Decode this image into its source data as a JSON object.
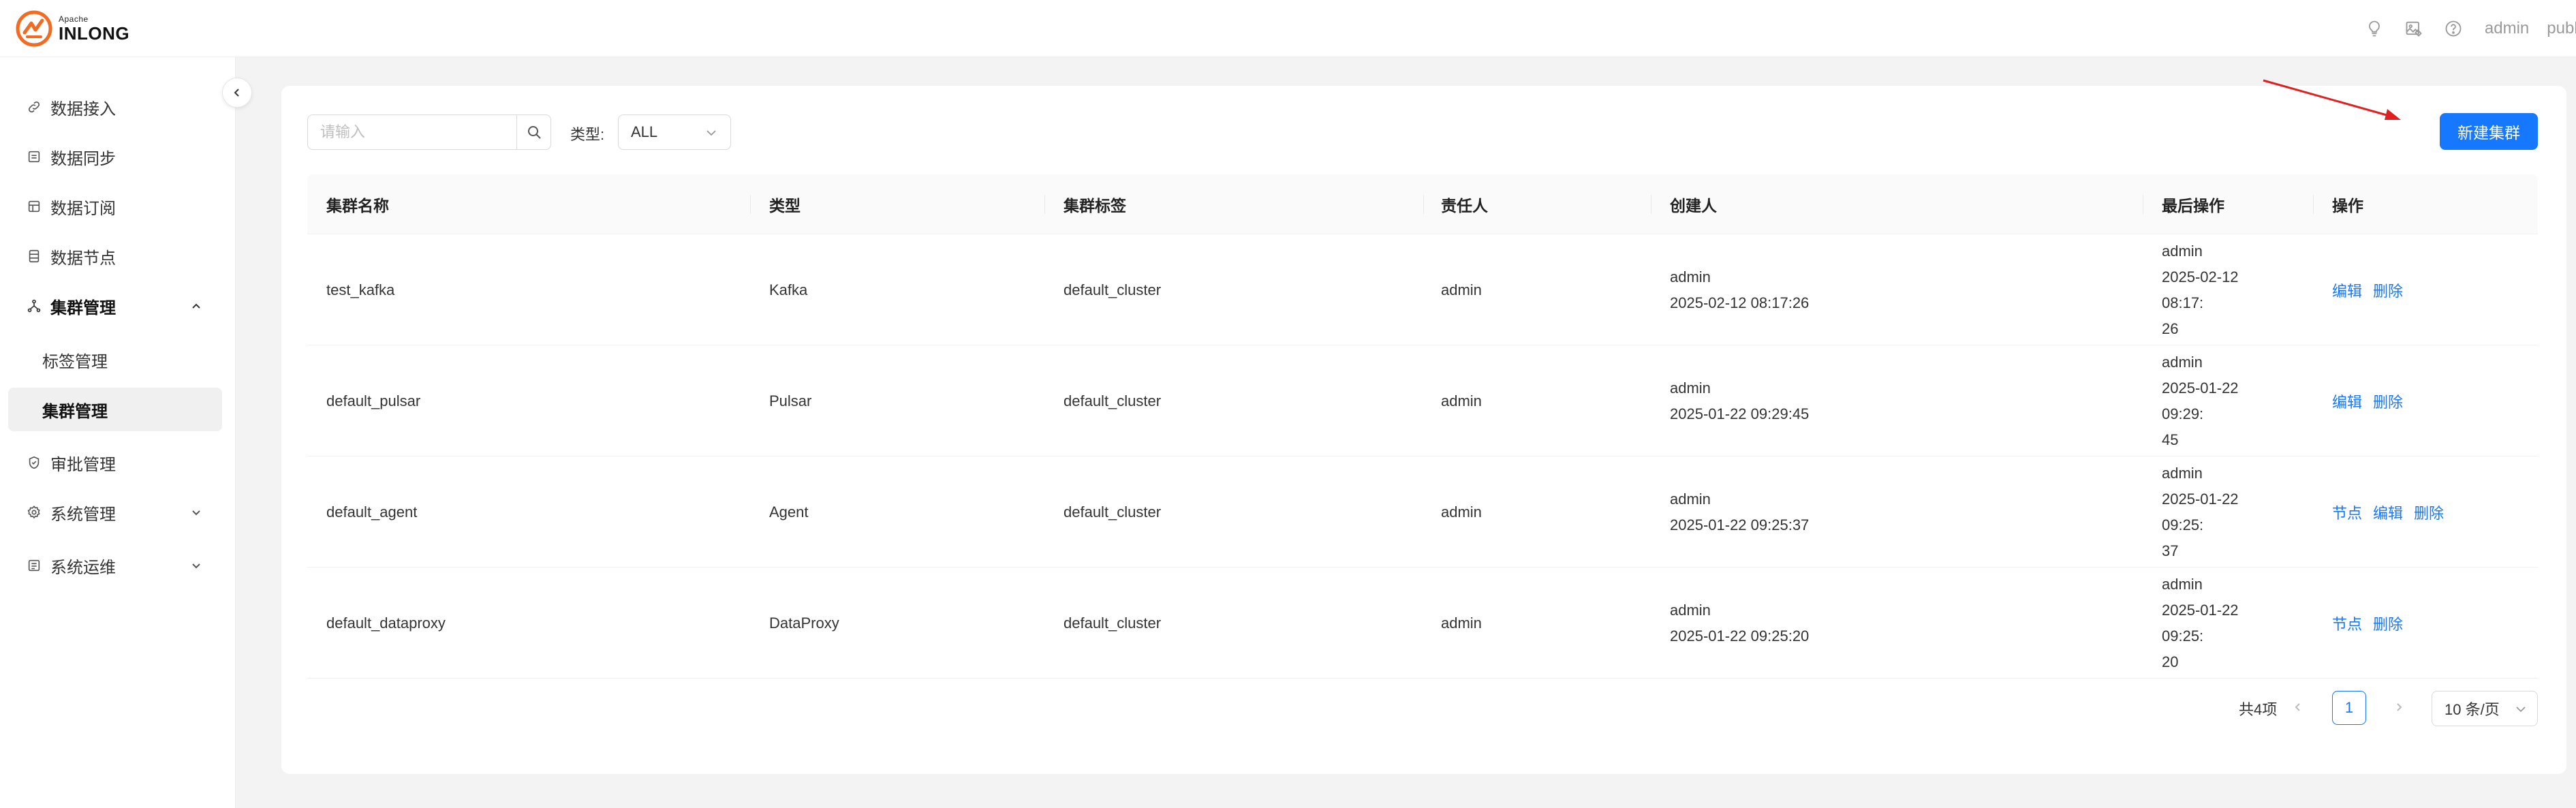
{
  "header": {
    "logo_apache": "Apache",
    "logo_inlong": "INLONG",
    "icons": [
      "bulb-icon",
      "image-edit-icon",
      "help-icon"
    ],
    "user": "admin",
    "tenant": "publi"
  },
  "sidebar": {
    "items": [
      {
        "label": "数据接入",
        "icon": "link-icon"
      },
      {
        "label": "数据同步",
        "icon": "sync-icon"
      },
      {
        "label": "数据订阅",
        "icon": "subscribe-icon"
      },
      {
        "label": "数据节点",
        "icon": "node-icon"
      },
      {
        "label": "集群管理",
        "icon": "cluster-icon",
        "expanded": true
      },
      {
        "label": "标签管理",
        "sub": true
      },
      {
        "label": "集群管理",
        "sub": true,
        "selected": true
      },
      {
        "label": "审批管理",
        "icon": "shield-icon"
      },
      {
        "label": "系统管理",
        "icon": "settings-icon"
      },
      {
        "label": "系统运维",
        "icon": "ops-icon"
      }
    ]
  },
  "toolbar": {
    "search_placeholder": "请输入",
    "type_label": "类型:",
    "type_value": "ALL",
    "new_button": "新建集群"
  },
  "table": {
    "columns": [
      "集群名称",
      "类型",
      "集群标签",
      "责任人",
      "创建人",
      "最后操作",
      "操作"
    ],
    "rows": [
      {
        "name": "test_kafka",
        "type": "Kafka",
        "tag": "default_cluster",
        "owner": "admin",
        "creator": "admin",
        "created": "2025-02-12 08:17:26",
        "modifier": "admin",
        "modified_a": "2025-02-12 08:17:",
        "modified_b": "26",
        "actions": [
          "编辑",
          "删除"
        ]
      },
      {
        "name": "default_pulsar",
        "type": "Pulsar",
        "tag": "default_cluster",
        "owner": "admin",
        "creator": "admin",
        "created": "2025-01-22 09:29:45",
        "modifier": "admin",
        "modified_a": "2025-01-22 09:29:",
        "modified_b": "45",
        "actions": [
          "编辑",
          "删除"
        ]
      },
      {
        "name": "default_agent",
        "type": "Agent",
        "tag": "default_cluster",
        "owner": "admin",
        "creator": "admin",
        "created": "2025-01-22 09:25:37",
        "modifier": "admin",
        "modified_a": "2025-01-22 09:25:",
        "modified_b": "37",
        "actions": [
          "节点",
          "编辑",
          "删除"
        ]
      },
      {
        "name": "default_dataproxy",
        "type": "DataProxy",
        "tag": "default_cluster",
        "owner": "admin",
        "creator": "admin",
        "created": "2025-01-22 09:25:20",
        "modifier": "admin",
        "modified_a": "2025-01-22 09:25:",
        "modified_b": "20",
        "actions": [
          "节点",
          "删除"
        ]
      }
    ]
  },
  "pagination": {
    "total": "共4项",
    "current": "1",
    "page_size": "10 条/页"
  },
  "colors": {
    "primary": "#1677ff",
    "annotation_arrow": "#e02020",
    "logo_orange": "#f26b21"
  }
}
